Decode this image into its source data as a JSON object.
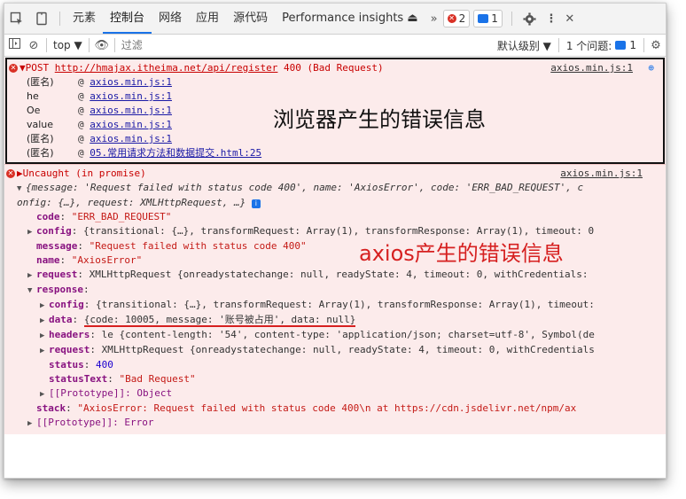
{
  "tabbar": {
    "tabs": [
      "元素",
      "控制台",
      "网络",
      "应用",
      "源代码",
      "Performance insights"
    ],
    "active": "控制台",
    "more": "»",
    "error_count": "2",
    "message_count": "1"
  },
  "filterbar": {
    "context": "top ▼",
    "filter_placeholder": "过滤",
    "level": "默认级别 ▼",
    "issues_label": "1 个问题:",
    "issues_count": "1"
  },
  "error1": {
    "method": "▼POST",
    "url": "http://hmajax.itheima.net/api/register",
    "status": "400 (Bad Request)",
    "source": "axios.min.js:1",
    "stack": [
      {
        "fn": "(匿名)",
        "at": "@",
        "link": "axios.min.js:1"
      },
      {
        "fn": "he",
        "at": "@",
        "link": "axios.min.js:1"
      },
      {
        "fn": "Oe",
        "at": "@",
        "link": "axios.min.js:1"
      },
      {
        "fn": "value",
        "at": "@",
        "link": "axios.min.js:1"
      },
      {
        "fn": "(匿名)",
        "at": "@",
        "link": "axios.min.js:1"
      },
      {
        "fn": "(匿名)",
        "at": "@",
        "link": "05.常用请求方法和数据提交.html:25"
      }
    ],
    "annotation": "浏览器产生的错误信息"
  },
  "error2": {
    "head": "▶Uncaught (in promise)",
    "source": "axios.min.js:1",
    "summary1": "{message: 'Request failed with status code 400', name: 'AxiosError', code: 'ERR_BAD_REQUEST', c",
    "summary2": "onfig: {…}, request: XMLHttpRequest, …}",
    "annotation": "axios产生的错误信息",
    "lines": {
      "code_key": "code",
      "code_val": "\"ERR_BAD_REQUEST\"",
      "config_key": "config",
      "config_val": "{transitional: {…}, transformRequest: Array(1), transformResponse: Array(1), timeout: 0",
      "message_key": "message",
      "message_val": "\"Request failed with status code 400\"",
      "name_key": "name",
      "name_val": "\"AxiosError\"",
      "request_key": "request",
      "request_val": "XMLHttpRequest {onreadystatechange: null, readyState: 4, timeout: 0, withCredentials: ",
      "response_key": "response",
      "r_config_key": "config",
      "r_config_val": "{transitional: {…}, transformRequest: Array(1), transformResponse: Array(1), timeout:",
      "r_data_key": "data",
      "r_data_val": "{code: 10005, message: '账号被占用', data: null}",
      "r_headers_key": "headers",
      "r_headers_val": "le {content-length: '54', content-type: 'application/json; charset=utf-8', Symbol(de",
      "r_request_key": "request",
      "r_request_val": "XMLHttpRequest {onreadystatechange: null, readyState: 4, timeout: 0, withCredentials",
      "r_status_key": "status",
      "r_status_val": "400",
      "r_statustext_key": "statusText",
      "r_statustext_val": "\"Bad Request\"",
      "r_proto": "[[Prototype]]: Object",
      "stack_key": "stack",
      "stack_val": "\"AxiosError: Request failed with status code 400\\n    at https://cdn.jsdelivr.net/npm/ax",
      "proto": "[[Prototype]]: Error"
    }
  }
}
